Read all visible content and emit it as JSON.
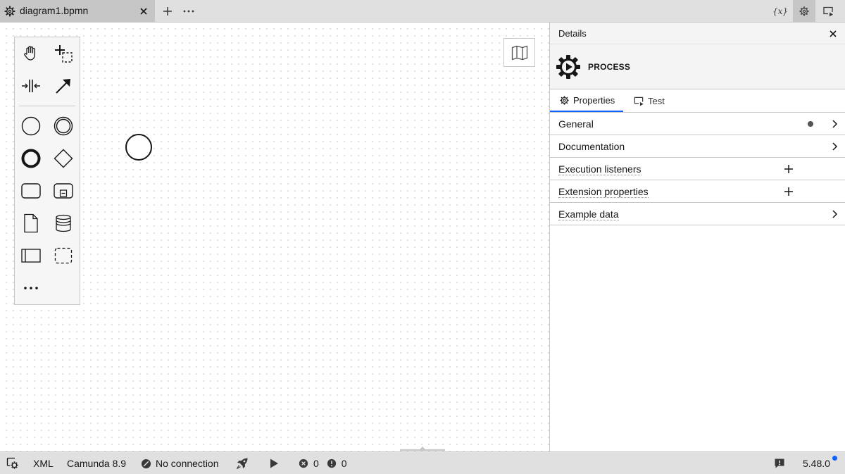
{
  "tab": {
    "title": "diagram1.bpmn"
  },
  "topbar_right": {
    "variables_label": "{x}"
  },
  "panel": {
    "title": "Details",
    "element_type": "PROCESS",
    "tabs": [
      {
        "label": "Properties",
        "active": true
      },
      {
        "label": "Test",
        "active": false
      }
    ],
    "groups": [
      {
        "label": "General",
        "action": "chevron",
        "has_data": true
      },
      {
        "label": "Documentation",
        "action": "chevron"
      },
      {
        "label": "Execution listeners",
        "action": "add"
      },
      {
        "label": "Extension properties",
        "action": "add"
      },
      {
        "label": "Example data",
        "action": "chevron"
      }
    ]
  },
  "statusbar": {
    "format": "XML",
    "engine": "Camunda 8.9",
    "connection": "No connection",
    "errors": "0",
    "warnings": "0",
    "version": "5.48.0"
  },
  "colors": {
    "accent": "#0f62fe",
    "tab_active": "#c6c6c6",
    "bar": "#e0e0e0"
  }
}
